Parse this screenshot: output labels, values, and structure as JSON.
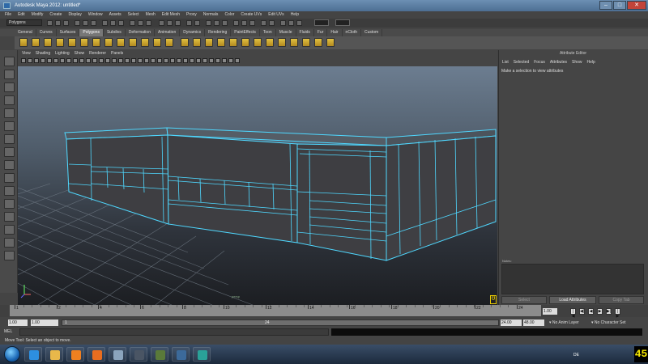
{
  "window": {
    "title": "Autodesk Maya 2012: untitled*",
    "min": "–",
    "max": "□",
    "close": "✕"
  },
  "menubar": [
    "File",
    "Edit",
    "Modify",
    "Create",
    "Display",
    "Window",
    "Assets",
    "Select",
    "Mesh",
    "Edit Mesh",
    "Proxy",
    "Normals",
    "Color",
    "Create UVs",
    "Edit UVs",
    "Help"
  ],
  "status": {
    "mode": "Polygons"
  },
  "shelf_tabs": [
    "General",
    "Curves",
    "Surfaces",
    "Polygons",
    "Subdivs",
    "Deformation",
    "Animation",
    "Dynamics",
    "Rendering",
    "PaintEffects",
    "Toon",
    "Muscle",
    "Fluids",
    "Fur",
    "Hair",
    "nCloth",
    "Custom"
  ],
  "shelf_active": "Polygons",
  "panel_menus": [
    "View",
    "Shading",
    "Lighting",
    "Show",
    "Renderer",
    "Panels"
  ],
  "viewport": {
    "label": "persp",
    "counter": "0"
  },
  "attribute_editor": {
    "title": "Attribute Editor",
    "menus": [
      "List",
      "Selected",
      "Focus",
      "Attributes",
      "Show",
      "Help"
    ],
    "hint": "Make a selection to view attributes",
    "notes_label": "Notes:",
    "buttons": {
      "select": "Select",
      "load": "Load Attributes",
      "copy": "Copy Tab"
    }
  },
  "timeline": {
    "ticks": [
      "1",
      "2",
      "4",
      "6",
      "8",
      "10",
      "12",
      "14",
      "16",
      "18",
      "20",
      "22",
      "24"
    ],
    "current_frame": "1.00"
  },
  "range": {
    "start": "1.00",
    "start2": "1.00",
    "slider_start": "1",
    "slider_end": "24",
    "end": "24.00",
    "end2": "48.00",
    "anim_layer": "No Anim Layer",
    "char_set": "No Character Set"
  },
  "playback": [
    "|◀",
    "◀|",
    "◀",
    "▶",
    "▶|",
    "|▶"
  ],
  "command": {
    "label": "MEL"
  },
  "help_line": "Move Tool: Select an object to move.",
  "taskbar": {
    "apps": [
      {
        "name": "ie-icon",
        "color": "#2d8fe0"
      },
      {
        "name": "explorer-icon",
        "color": "#e8b84a"
      },
      {
        "name": "media-player-icon",
        "color": "#f08020"
      },
      {
        "name": "firefox-icon",
        "color": "#e96d1f"
      },
      {
        "name": "calculator-icon",
        "color": "#8ba4bd"
      },
      {
        "name": "steam-icon",
        "color": "#4a5564"
      },
      {
        "name": "game-icon",
        "color": "#5a7a3a"
      },
      {
        "name": "monitor-icon",
        "color": "#3c6a9a"
      },
      {
        "name": "maya-icon",
        "color": "#2aa198"
      }
    ],
    "lang": "DE",
    "clock": "45"
  }
}
